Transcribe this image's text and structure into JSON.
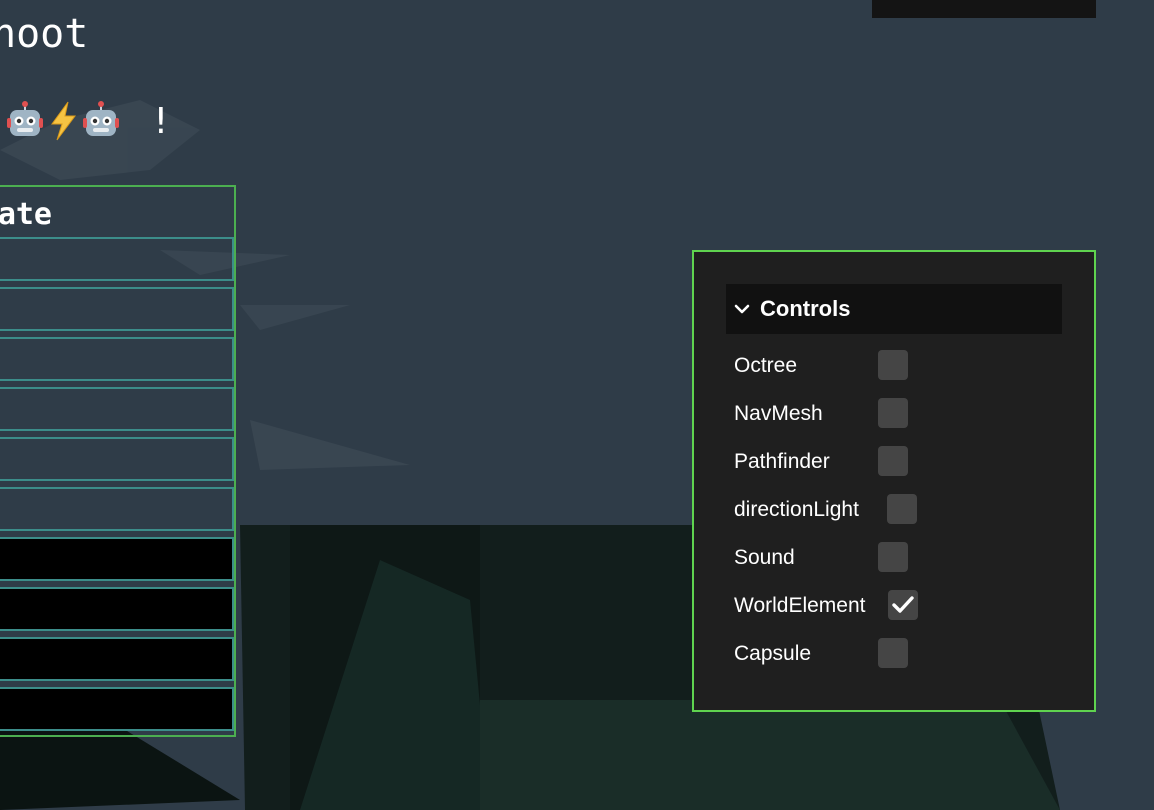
{
  "header": {
    "title": "hoot",
    "robot_left_icon": "robot-face-icon",
    "bolt_icon": "lightning-bolt-icon",
    "robot_right_icon": "robot-face-icon",
    "exclamation": "!"
  },
  "state_panel": {
    "title": "ate",
    "rows": [
      {
        "style": "outline"
      },
      {
        "style": "outline"
      },
      {
        "style": "outline"
      },
      {
        "style": "outline"
      },
      {
        "style": "outline"
      },
      {
        "style": "outline"
      },
      {
        "style": "filled"
      },
      {
        "style": "filled"
      },
      {
        "style": "filled"
      },
      {
        "style": "filled"
      }
    ]
  },
  "controls": {
    "title": "Controls",
    "chevron_icon": "chevron-down-icon",
    "items": [
      {
        "label": "Octree",
        "checked": false
      },
      {
        "label": "NavMesh",
        "checked": false
      },
      {
        "label": "Pathfinder",
        "checked": false
      },
      {
        "label": "directionLight",
        "checked": false
      },
      {
        "label": "Sound",
        "checked": false
      },
      {
        "label": "WorldElement",
        "checked": true
      },
      {
        "label": "Capsule",
        "checked": false
      }
    ]
  },
  "colors": {
    "background": "#2f3c48",
    "panel_border": "#5fd34f",
    "state_border": "#4caf50",
    "row_border": "#3c8d8a",
    "panel_bg": "#1f1f1f",
    "checkbox_bg": "#454545"
  }
}
